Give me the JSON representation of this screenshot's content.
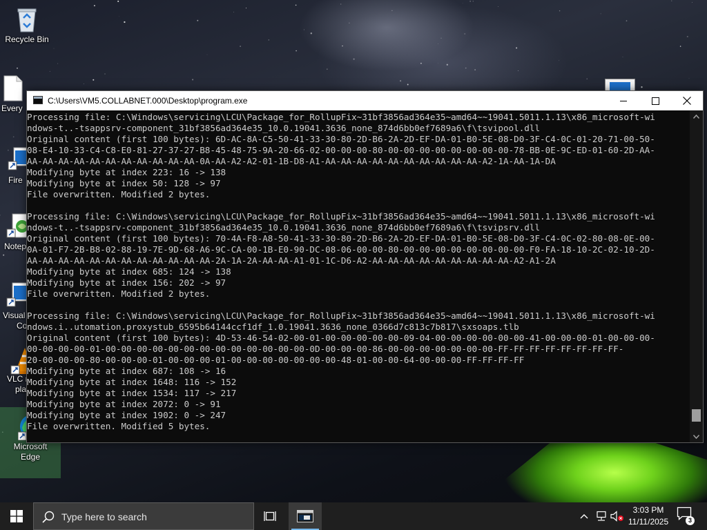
{
  "desktop": {
    "icons": [
      {
        "label": "Recycle Bin",
        "icon": "recycle-bin-icon"
      },
      {
        "label": "Every",
        "icon": "document-icon"
      },
      {
        "label": "Fire",
        "icon": "shortcut-icon"
      },
      {
        "label": "Notep",
        "icon": "notepad-icon"
      },
      {
        "label": "Visual",
        "label2": "Co",
        "icon": "shortcut-icon"
      },
      {
        "label": "VLC r",
        "label2": "pla",
        "icon": "vlc-icon"
      },
      {
        "label": "Microsoft",
        "label2": "Edge",
        "icon": "edge-icon"
      }
    ]
  },
  "window": {
    "title": "C:\\Users\\VM5.COLLABNET.000\\Desktop\\program.exe",
    "controls": {
      "minimize": "minimize-icon",
      "maximize": "maximize-icon",
      "close": "close-icon"
    },
    "lines": [
      "Processing file: C:\\Windows\\servicing\\LCU\\Package_for_RollupFix~31bf3856ad364e35~amd64~~19041.5011.1.13\\x86_microsoft-wi",
      "ndows-t..-tsappsrv-component_31bf3856ad364e35_10.0.19041.3636_none_874d6bb0ef7689a6\\f\\tsvipool.dll",
      "Original content (first 100 bytes): 6D-AC-8A-C5-50-41-33-30-80-2D-B6-2A-2D-EF-DA-01-B0-5E-08-D0-3F-C4-0C-01-20-71-00-50-",
      "08-E4-10-33-C4-C8-E0-81-27-37-27-B8-45-48-75-9A-20-66-02-00-00-00-80-00-00-00-00-00-00-00-00-78-BB-0E-9C-ED-01-60-2D-AA-",
      "AA-AA-AA-AA-AA-AA-AA-AA-AA-AA-AA-0A-AA-A2-A2-01-1B-D8-A1-AA-AA-AA-AA-AA-AA-AA-AA-AA-AA-A2-1A-AA-1A-DA",
      "Modifying byte at index 223: 16 -> 138",
      "Modifying byte at index 50: 128 -> 97",
      "File overwritten. Modified 2 bytes.",
      "",
      "Processing file: C:\\Windows\\servicing\\LCU\\Package_for_RollupFix~31bf3856ad364e35~amd64~~19041.5011.1.13\\x86_microsoft-wi",
      "ndows-t..-tsappsrv-component_31bf3856ad364e35_10.0.19041.3636_none_874d6bb0ef7689a6\\f\\tsvipsrv.dll",
      "Original content (first 100 bytes): 70-4A-F8-A8-50-41-33-30-80-2D-B6-2A-2D-EF-DA-01-B0-5E-08-D0-3F-C4-0C-02-80-08-0E-00-",
      "0A-01-F7-2B-B8-02-88-19-7E-9D-68-A6-9C-CA-00-1B-E0-90-DC-08-06-00-00-80-00-00-00-00-00-00-00-00-F0-FA-18-10-2C-02-10-2D-",
      "AA-AA-AA-AA-AA-AA-AA-AA-AA-AA-AA-AA-2A-1A-2A-AA-AA-A1-01-1C-D6-A2-AA-AA-AA-AA-AA-AA-AA-AA-AA-A2-A1-2A",
      "Modifying byte at index 685: 124 -> 138",
      "Modifying byte at index 156: 202 -> 97",
      "File overwritten. Modified 2 bytes.",
      "",
      "Processing file: C:\\Windows\\servicing\\LCU\\Package_for_RollupFix~31bf3856ad364e35~amd64~~19041.5011.1.13\\x86_microsoft-wi",
      "ndows.i..utomation.proxystub_6595b64144ccf1df_1.0.19041.3636_none_0366d7c813c7b817\\sxsoaps.tlb",
      "Original content (first 100 bytes): 4D-53-46-54-02-00-01-00-00-00-00-00-09-04-00-00-00-00-00-00-41-00-00-00-01-00-00-00-",
      "00-00-00-00-01-00-00-00-00-00-00-00-00-00-00-00-00-00-0D-00-00-00-86-00-00-00-00-00-00-00-FF-FF-FF-FF-FF-FF-FF-FF-",
      "20-00-00-00-80-00-00-00-01-00-00-00-01-00-00-00-00-00-00-00-48-01-00-00-64-00-00-00-FF-FF-FF-FF",
      "Modifying byte at index 687: 108 -> 16",
      "Modifying byte at index 1648: 116 -> 152",
      "Modifying byte at index 1534: 117 -> 217",
      "Modifying byte at index 2072: 0 -> 91",
      "Modifying byte at index 1902: 0 -> 247",
      "File overwritten. Modified 5 bytes."
    ],
    "scroll_position": 0.97
  },
  "taskbar": {
    "search_placeholder": "Type here to search",
    "time": "3:03 PM",
    "date": "11/11/2025",
    "notification_count": "3",
    "accent": "#76b9ed"
  }
}
